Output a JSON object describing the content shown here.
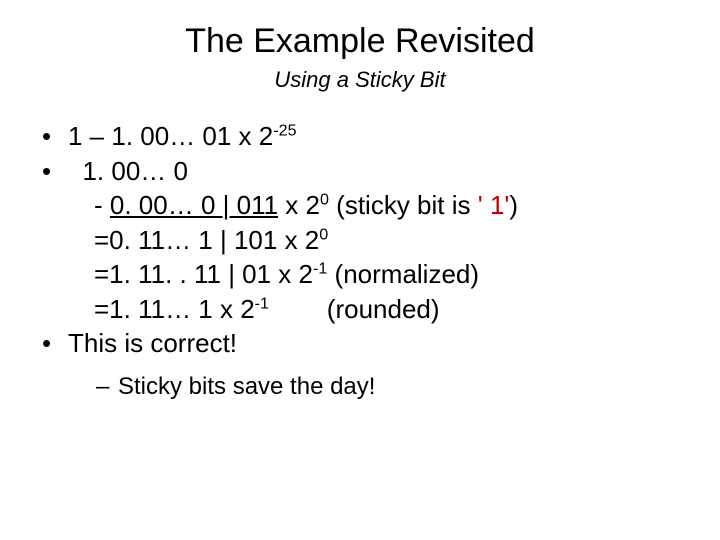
{
  "title": "The Example Revisited",
  "subtitle": "Using a Sticky Bit",
  "b1_a": "1 – 1. 00… 01 x 2",
  "b1_sup": "-25",
  "b2": "  1. 00… 0",
  "c1_a": "- ",
  "c1_u": "0. 00… 0 | 011",
  "c1_b": " x 2",
  "c1_sup": "0",
  "c1_c": " (sticky bit is ",
  "c1_red": "' 1'",
  "c1_d": ")",
  "c2_a": "=0. 11… 1 | 101 x 2",
  "c2_sup": "0",
  "c3_a": "=1. 11. . 11 | 01 x 2",
  "c3_sup": "-1",
  "c3_b": " (normalized)",
  "c4_a": "=1. 11… 1 x 2",
  "c4_sup": "-1",
  "c4_b": "        (rounded)",
  "b3": "This is correct!",
  "s1": "Sticky bits save the day!"
}
